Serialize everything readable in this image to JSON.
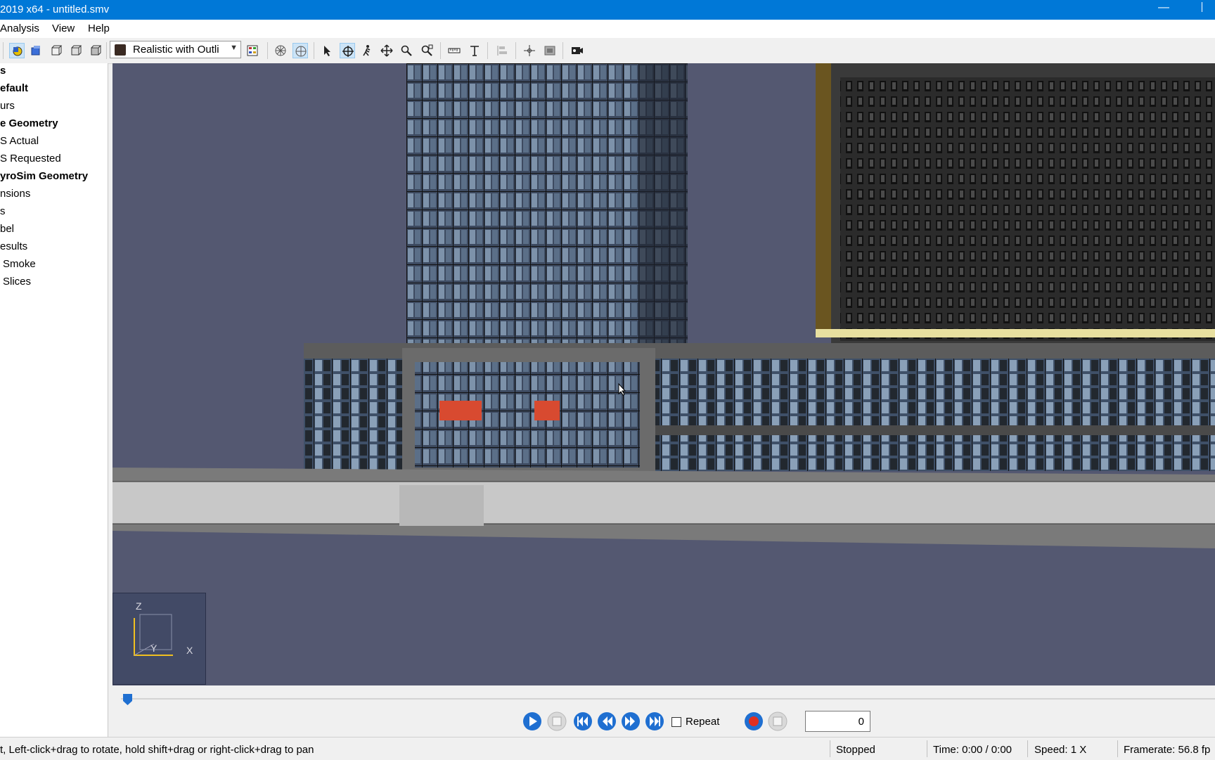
{
  "window": {
    "title": "2019 x64 - untitled.smv"
  },
  "menu": [
    "Analysis",
    "View",
    "Help"
  ],
  "toolbar": {
    "render_mode": "Realistic with Outli",
    "icons": [
      "select-objects-icon",
      "blue-cube-icon",
      "cube-view-1-icon",
      "cube-view-2-icon",
      "cube-view-3-icon",
      "render-mode-icon",
      "color-palette-icon",
      "wireframe-icon",
      "solid-view-icon",
      "pointer-icon",
      "orbit-icon",
      "walk-icon",
      "pan-icon",
      "zoom-icon",
      "zoom-box-icon",
      "measure-icon",
      "text-icon",
      "align-icon",
      "center-icon",
      "snapshot-icon",
      "record-icon"
    ]
  },
  "navigator": {
    "items": [
      {
        "label": "s",
        "bold": true
      },
      {
        "label": "efault",
        "bold": true
      },
      {
        "label": "urs",
        "bold": false
      },
      {
        "label": "e Geometry",
        "bold": true
      },
      {
        "label": "S Actual",
        "bold": false
      },
      {
        "label": "S Requested",
        "bold": false
      },
      {
        "label": "yroSim Geometry",
        "bold": true
      },
      {
        "label": "nsions",
        "bold": false
      },
      {
        "label": "s",
        "bold": false
      },
      {
        "label": "bel",
        "bold": false
      },
      {
        "label": "esults",
        "bold": false
      },
      {
        "label": "Smoke",
        "bold": false
      },
      {
        "label": "Slices",
        "bold": false
      }
    ]
  },
  "axes": {
    "x": "X",
    "y": "Y",
    "z": "Z"
  },
  "playback": {
    "repeat_label": "Repeat",
    "repeat_checked": false,
    "frame": "0",
    "progress": 0
  },
  "status": {
    "hint": "t, Left-click+drag to rotate, hold shift+drag or right-click+drag to pan",
    "state": "Stopped",
    "time": "Time: 0:00 / 0:00",
    "speed": "Speed: 1 X",
    "framerate": "Framerate: 56.8 fp"
  },
  "colors": {
    "titlebar": "#0078d7",
    "viewport": "#545871",
    "accent": "#1f6fd1",
    "record": "#e03020"
  }
}
